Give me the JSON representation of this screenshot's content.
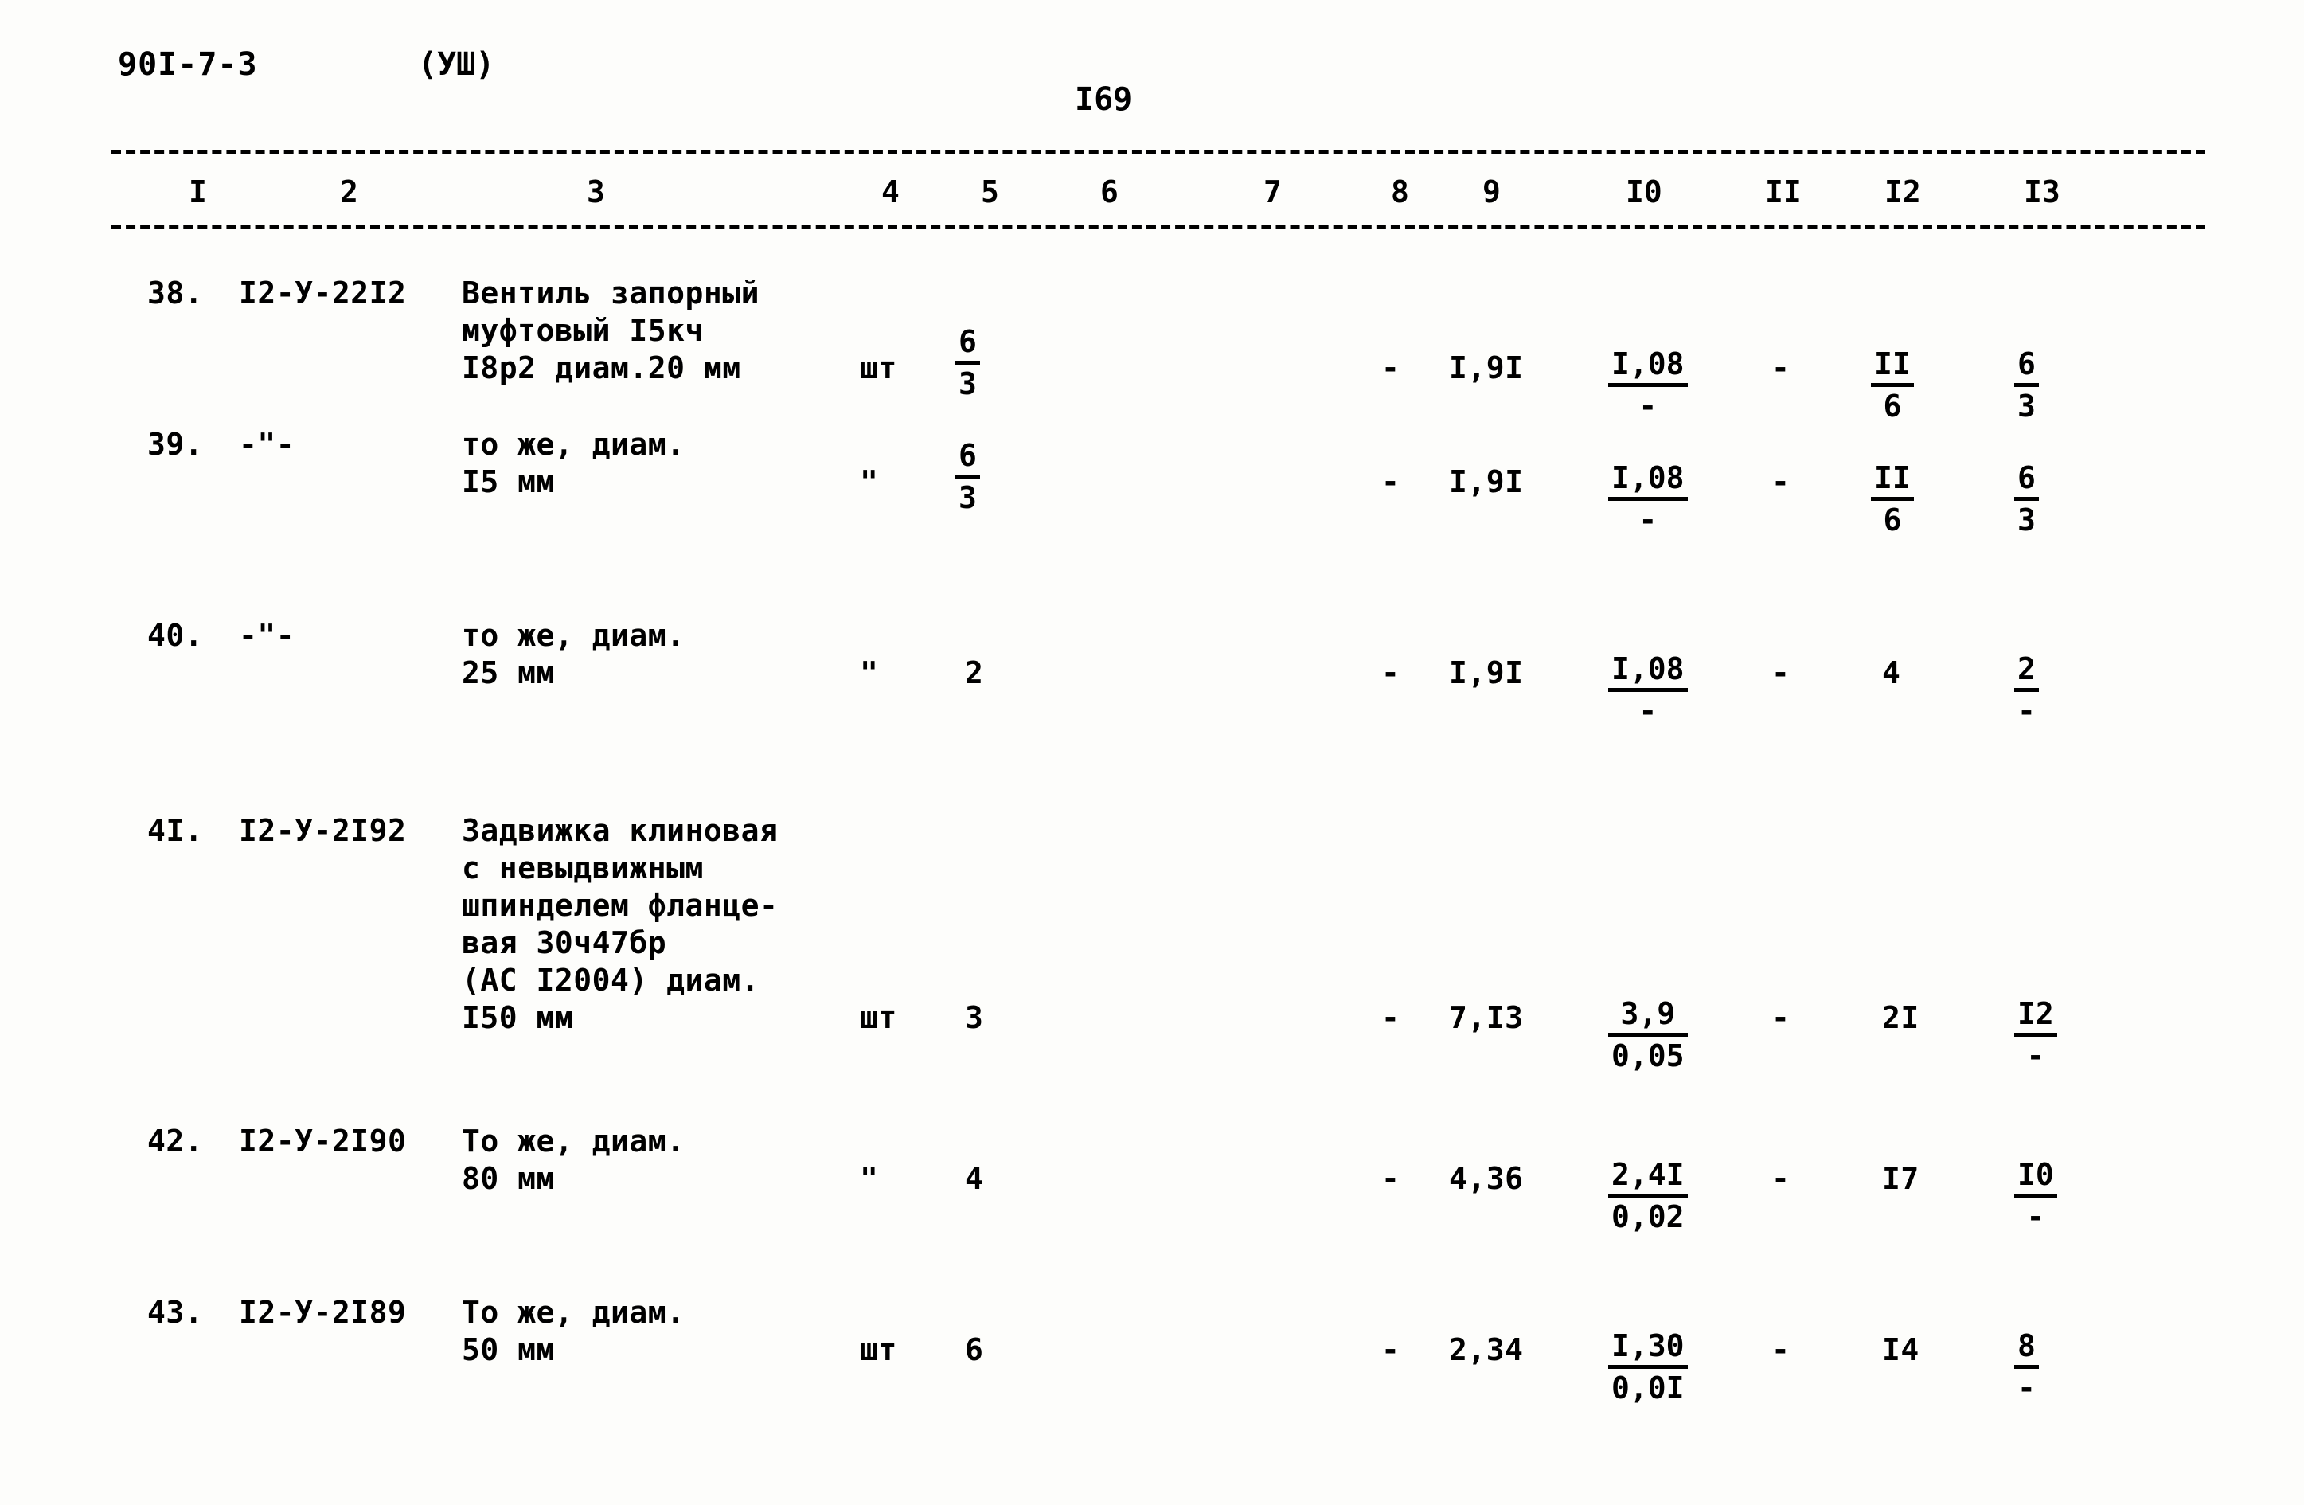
{
  "header": {
    "doc_code": "90I-7-3",
    "series": "(УШ)",
    "page_number": "I69"
  },
  "table": {
    "column_numbers": [
      "I",
      "2",
      "3",
      "4",
      "5",
      "6",
      "7",
      "8",
      "9",
      "I0",
      "II",
      "I2",
      "I3"
    ],
    "rows": [
      {
        "no": "38.",
        "code": "I2-У-22I2",
        "desc_lines": [
          "Вентиль запорный",
          "муфтовый I5кч",
          "I8р2 диам.20 мм"
        ],
        "unit": "шт",
        "qty_num": "6",
        "qty_den": "3",
        "qty_is_fraction": true,
        "c6": "",
        "c7": "",
        "c8": "-",
        "c9": "I,9I",
        "c10_num": "I,08",
        "c10_den": "-",
        "c11": "-",
        "c12_num": "II",
        "c12_den": "6",
        "c13_num": "6",
        "c13_den": "3"
      },
      {
        "no": "39.",
        "code": "-\"-",
        "desc_lines": [
          "то же, диам.",
          "I5 мм"
        ],
        "unit": "\"",
        "qty_num": "6",
        "qty_den": "3",
        "qty_is_fraction": true,
        "c6": "",
        "c7": "",
        "c8": "-",
        "c9": "I,9I",
        "c10_num": "I,08",
        "c10_den": "-",
        "c11": "-",
        "c12_num": "II",
        "c12_den": "6",
        "c13_num": "6",
        "c13_den": "3"
      },
      {
        "no": "40.",
        "code": "-\"-",
        "desc_lines": [
          "то же, диам.",
          "25 мм"
        ],
        "unit": "\"",
        "qty_num": "2",
        "qty_den": "",
        "qty_is_fraction": false,
        "c6": "",
        "c7": "",
        "c8": "-",
        "c9": "I,9I",
        "c10_num": "I,08",
        "c10_den": "-",
        "c11": "-",
        "c12_num": "4",
        "c12_den": "",
        "c13_num": "2",
        "c13_den": "-"
      },
      {
        "no": "4I.",
        "code": "I2-У-2I92",
        "desc_lines": [
          "Задвижка клиновая",
          "с невыдвижным",
          "шпинделем фланце-",
          "вая 30ч47бр",
          "(АС I2004) диам.",
          "I50 мм"
        ],
        "unit": "шт",
        "qty_num": "3",
        "qty_den": "",
        "qty_is_fraction": false,
        "c6": "",
        "c7": "",
        "c8": "-",
        "c9": "7,I3",
        "c10_num": "3,9",
        "c10_den": "0,05",
        "c11": "-",
        "c12_num": "2I",
        "c12_den": "",
        "c13_num": "I2",
        "c13_den": "-"
      },
      {
        "no": "42.",
        "code": "I2-У-2I90",
        "desc_lines": [
          "То же, диам.",
          "80 мм"
        ],
        "unit": "\"",
        "qty_num": "4",
        "qty_den": "",
        "qty_is_fraction": false,
        "c6": "",
        "c7": "",
        "c8": "-",
        "c9": "4,36",
        "c10_num": "2,4I",
        "c10_den": "0,02",
        "c11": "-",
        "c12_num": "I7",
        "c12_den": "",
        "c13_num": "I0",
        "c13_den": "-"
      },
      {
        "no": "43.",
        "code": "I2-У-2I89",
        "desc_lines": [
          "То же, диам.",
          "50 мм"
        ],
        "unit": "шт",
        "qty_num": "6",
        "qty_den": "",
        "qty_is_fraction": false,
        "c6": "",
        "c7": "",
        "c8": "-",
        "c9": "2,34",
        "c10_num": "I,30",
        "c10_den": "0,0I",
        "c11": "-",
        "c12_num": "I4",
        "c12_den": "",
        "c13_num": "8",
        "c13_den": "-"
      }
    ]
  },
  "layout": {
    "col_x": {
      "no": 185,
      "code": 300,
      "desc": 580,
      "unit": 1080,
      "qty": 1200,
      "c6": 1360,
      "c7": 1560,
      "c8": 1735,
      "c9": 1820,
      "c10": 2020,
      "c11": 2225,
      "c12": 2350,
      "c13": 2530
    },
    "colnum_x": [
      230,
      420,
      730,
      1100,
      1225,
      1375,
      1580,
      1740,
      1855,
      2035,
      2210,
      2360,
      2535
    ],
    "row_y": [
      25,
      215,
      455,
      700,
      1090,
      1305,
      1515
    ],
    "row_desc_y": [
      25,
      215,
      455,
      695,
      1305,
      1515
    ]
  }
}
